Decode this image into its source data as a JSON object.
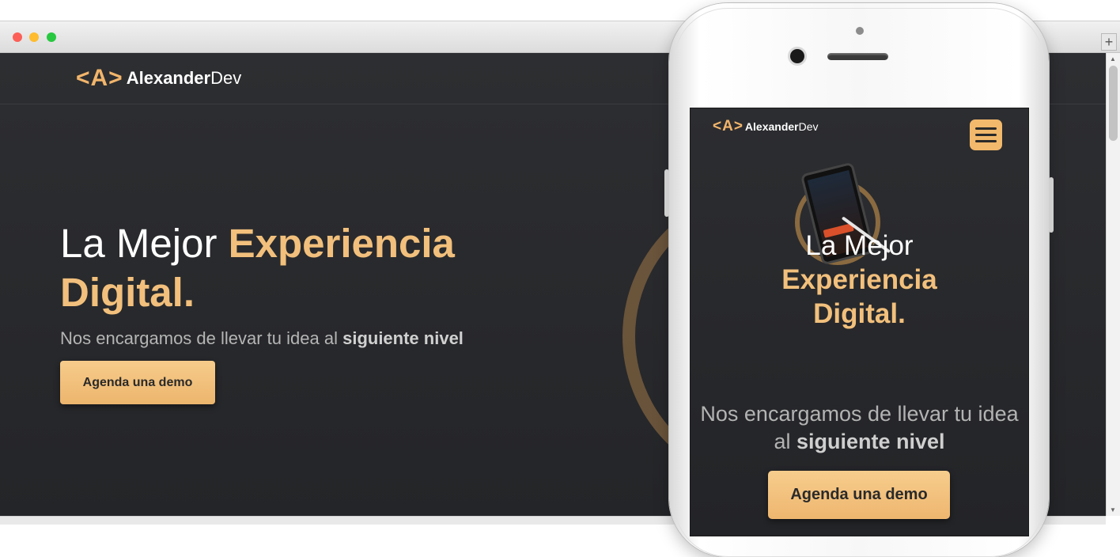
{
  "desktop": {
    "logo": {
      "mark": "<A>",
      "name_bold": "Alexander",
      "name_light": "Dev"
    },
    "hero": {
      "title_plain": "La Mejor ",
      "title_accent_1": "Experiencia",
      "title_accent_2": "Digital.",
      "subtitle_plain": "Nos encargamos de llevar tu idea al ",
      "subtitle_bold": "siguiente nivel",
      "cta_label": "Agenda una demo"
    },
    "window_buttons": {
      "new_tab": "+"
    }
  },
  "mobile": {
    "logo": {
      "mark": "<A>",
      "name_bold": "Alexander",
      "name_light": "Dev"
    },
    "hero": {
      "title_plain": "La Mejor",
      "title_accent_1": "Experiencia",
      "title_accent_2": "Digital.",
      "subtitle_plain": "Nos encargamos de llevar tu idea al ",
      "subtitle_bold": "siguiente nivel",
      "cta_label": "Agenda una demo"
    },
    "icons": {
      "menu": "hamburger-menu-icon"
    }
  },
  "colors": {
    "background": "#2a2b2e",
    "accent": "#f2c07c",
    "button": "#f4c27e",
    "text": "#ffffff",
    "muted_text": "#b5b5b5"
  }
}
